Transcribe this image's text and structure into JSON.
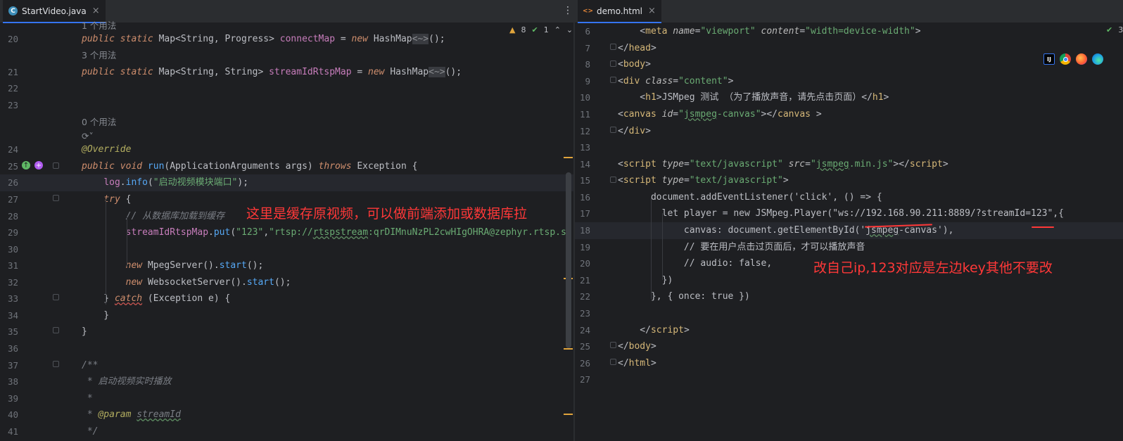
{
  "left_editor": {
    "tab": {
      "label": "StartVideo.java",
      "icon": "java-class-icon",
      "close": "×"
    },
    "menu": "⋮",
    "inspections": {
      "warnings": "8",
      "checks": "1",
      "up": "⌃",
      "down": "⌄"
    },
    "top_hint": "1 个用法",
    "annotation": "这里是缓存原视频，可以做前端添加或数据库拉"
  },
  "right_editor": {
    "tab": {
      "label": "demo.html",
      "icon": "html-file-icon",
      "close": "×"
    },
    "menu": "⋮",
    "inspections": {
      "checks": "3"
    },
    "annotation": "改自己ip,123对应是左边key其他不要改",
    "browser_icons": [
      "intellij-icon",
      "chrome-icon",
      "firefox-icon",
      "edge-icon"
    ]
  },
  "colors": {
    "background": "#1e1f22",
    "annotation_red": "#ff3838",
    "keyword": "#cf8e6d",
    "string": "#6aab73",
    "field": "#c77dbb",
    "function": "#56a8f5"
  }
}
